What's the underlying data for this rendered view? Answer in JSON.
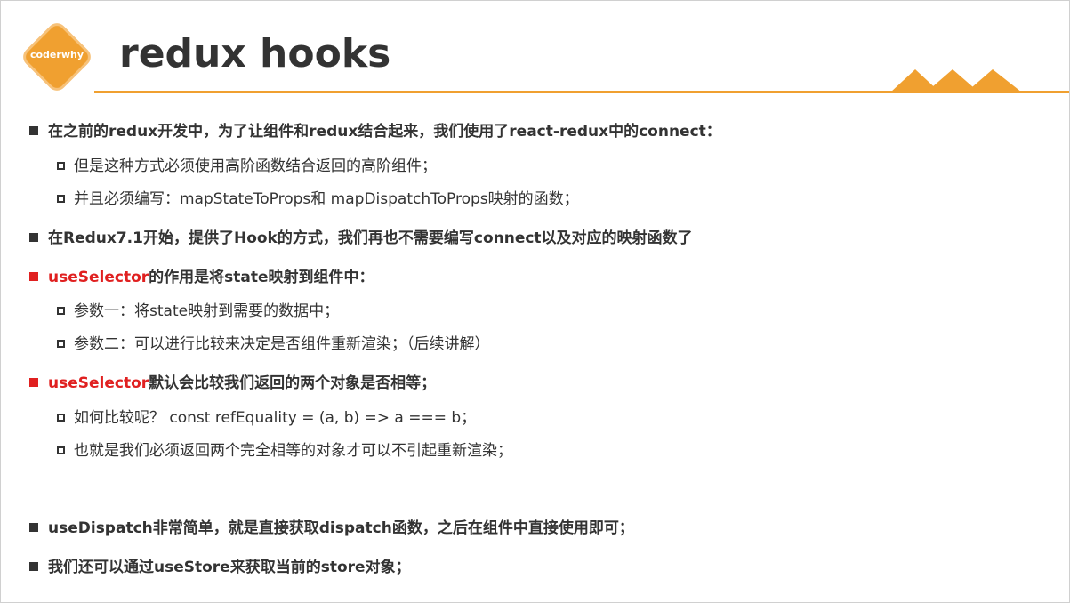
{
  "header": {
    "logo_text": "coderwhy",
    "title": "redux hooks",
    "accent_color": "#f0a030"
  },
  "bullets": [
    {
      "level": 1,
      "text": "在之前的redux开发中，为了让组件和redux结合起来，我们使用了react-redux中的connect："
    },
    {
      "level": 2,
      "text": "但是这种方式必须使用高阶函数结合返回的高阶组件；"
    },
    {
      "level": 2,
      "text": "并且必须编写：mapStateToProps和 mapDispatchToProps映射的函数；"
    },
    {
      "level": 1,
      "text": "在Redux7.1开始，提供了Hook的方式，我们再也不需要编写connect以及对应的映射函数了"
    },
    {
      "level": 1,
      "highlight": "useSelector",
      "text": "的作用是将state映射到组件中：",
      "bullet_color": "#e02020"
    },
    {
      "level": 2,
      "text": "参数一：将state映射到需要的数据中；"
    },
    {
      "level": 2,
      "text": "参数二：可以进行比较来决定是否组件重新渲染；（后续讲解）"
    },
    {
      "level": 1,
      "highlight": "useSelector",
      "text": "默认会比较我们返回的两个对象是否相等；",
      "bullet_color": "#e02020"
    },
    {
      "level": 2,
      "text": "如何比较呢？ const refEquality = (a, b) => a === b；"
    },
    {
      "level": 2,
      "text": "也就是我们必须返回两个完全相等的对象才可以不引起重新渲染；"
    },
    {
      "level": 1,
      "text": "useDispatch非常简单，就是直接获取dispatch函数，之后在组件中直接使用即可；"
    },
    {
      "level": 1,
      "text": "我们还可以通过useStore来获取当前的store对象；"
    }
  ]
}
